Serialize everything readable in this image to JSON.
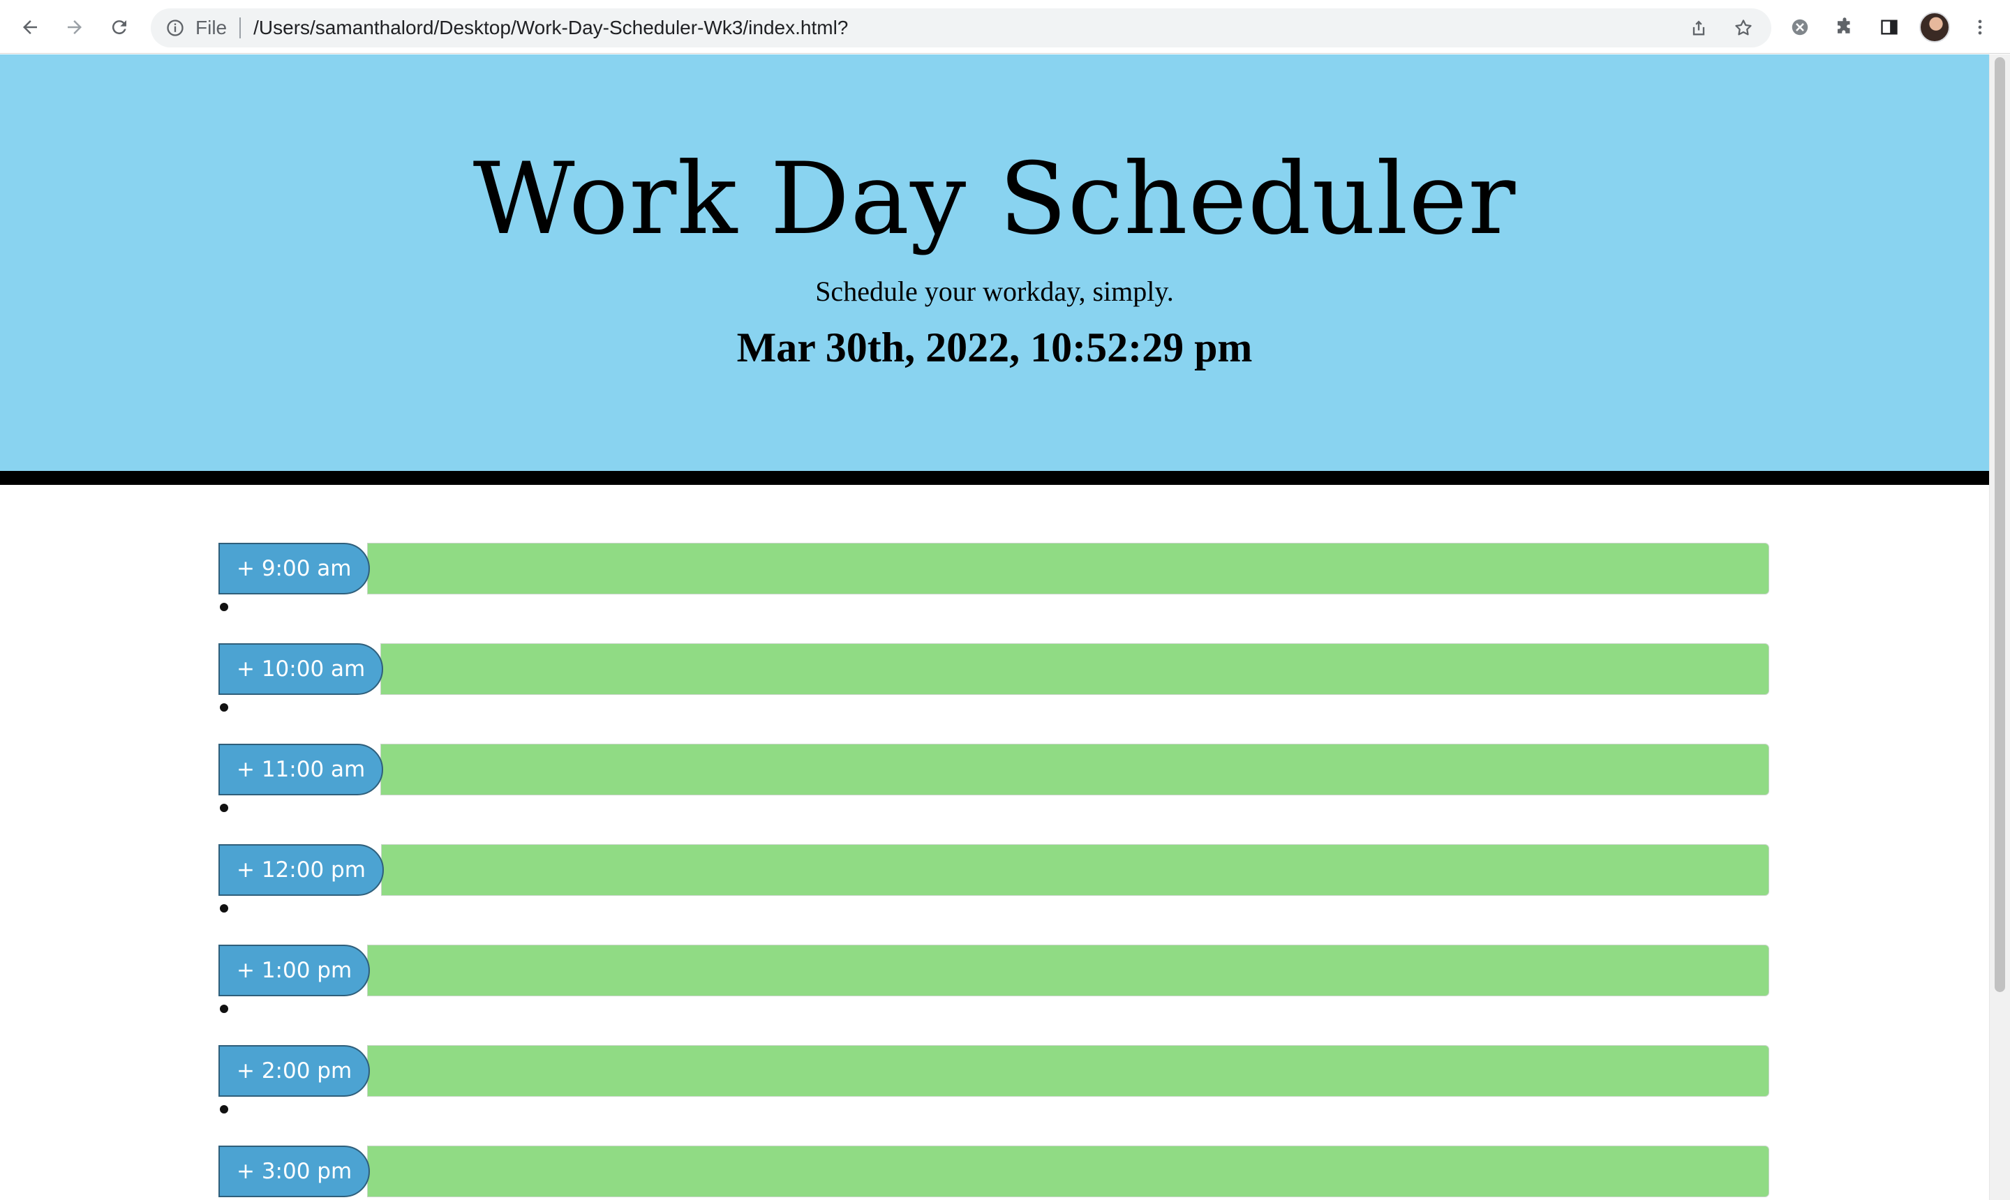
{
  "browser": {
    "scheme_label": "File",
    "url": "/Users/samanthalord/Desktop/Work-Day-Scheduler-Wk3/index.html?"
  },
  "header": {
    "title": "Work Day Scheduler",
    "subtitle": "Schedule your workday, simply.",
    "datetime": "Mar 30th, 2022, 10:52:29 pm"
  },
  "hours": [
    {
      "label": "+ 9:00 am"
    },
    {
      "label": "+ 10:00 am"
    },
    {
      "label": "+ 11:00 am"
    },
    {
      "label": "+ 12:00 pm"
    },
    {
      "label": "+ 1:00 pm"
    },
    {
      "label": "+ 2:00 pm"
    },
    {
      "label": "+ 3:00 pm"
    }
  ],
  "colors": {
    "header_bg": "#89d3f0",
    "hour_button": "#4ca3d2",
    "future_slot": "#90db84",
    "divider": "#000000"
  }
}
